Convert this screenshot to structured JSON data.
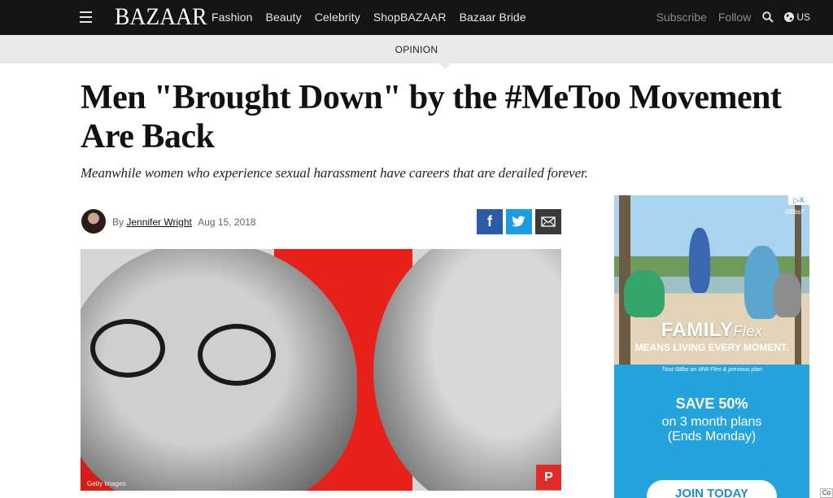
{
  "nav": {
    "logo": "BAZAAR",
    "links": [
      "Fashion",
      "Beauty",
      "Celebrity",
      "ShopBAZAAR",
      "Bazaar Bride"
    ],
    "subscribe": "Subscribe",
    "follow": "Follow",
    "region": "US"
  },
  "section": "OPINION",
  "article": {
    "headline": "Men \"Brought Down\" by the #MeToo Movement Are Back",
    "dek": "Meanwhile women who experience sexual harassment have careers that are derailed forever.",
    "byline_prefix": "By",
    "author": "Jennifer Wright",
    "date": "Aug 15, 2018",
    "image_credit": "Getty Images"
  },
  "share": {
    "facebook_glyph": "f",
    "pinterest_glyph": "P"
  },
  "ad": {
    "adchoice": "▷X",
    "lost": "-68lbs†",
    "brand_main": "FAMILY",
    "brand_script": "Flex",
    "tagline": "MEANS LIVING EVERY MOMENT.",
    "fine_print": "†lost 68lbs on WW Flex & previous plan",
    "save": "SAVE 50%",
    "plans": "on 3 month plans",
    "ends": "(Ends Monday)",
    "cta": "JOIN TODAY"
  },
  "edge_label": "Co",
  "colors": {
    "nav_bg": "#141414",
    "section_bg": "#eaeaea",
    "facebook": "#2d5aa8",
    "twitter": "#1d9be3",
    "pinterest": "#e02b27",
    "ad_blue": "#25a3dc"
  }
}
